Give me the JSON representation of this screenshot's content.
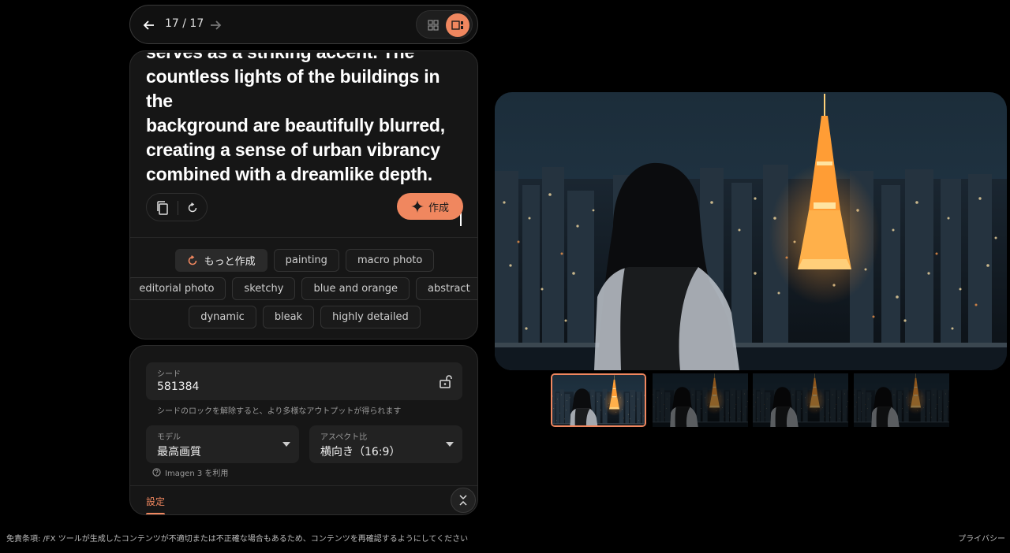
{
  "pager": {
    "counter": "17 / 17",
    "back_icon": "arrow-left-icon",
    "forward_icon": "arrow-right-icon"
  },
  "view_toggle": {
    "grid_icon": "grid-view-icon",
    "single_icon": "single-view-icon",
    "active": "single"
  },
  "prompt": {
    "lines": [
      "serves as a striking accent. The",
      "countless lights of the buildings in the",
      "background are beautifully blurred,",
      "creating a sense of urban vibrancy",
      "combined with a dreamlike depth."
    ],
    "create_label": "作成"
  },
  "chips": {
    "more_label": "もっと作成",
    "rows": [
      [
        "painting",
        "macro photo"
      ],
      [
        "editorial photo",
        "sketchy",
        "blue and orange",
        "abstract"
      ],
      [
        "dynamic",
        "bleak",
        "highly detailed"
      ]
    ]
  },
  "settings": {
    "seed_label": "シード",
    "seed_value": "581384",
    "seed_hint": "シードのロックを解除すると、より多様なアウトプットが得られます",
    "model_label": "モデル",
    "model_value": "最高画質",
    "aspect_label": "アスペクト比",
    "aspect_value": "横向き（16:9）",
    "imagen_hint": "Imagen 3 を利用",
    "tab_label": "設定"
  },
  "colors": {
    "accent": "#f0875f",
    "background": "#000000",
    "panel": "#161616"
  },
  "footer": {
    "disclaimer": "免責条項: /FX ツールが生成したコンテンツが不適切または不正確な場合もあるため、コンテンツを再確認するようにしてください",
    "privacy": "プライバシー"
  }
}
